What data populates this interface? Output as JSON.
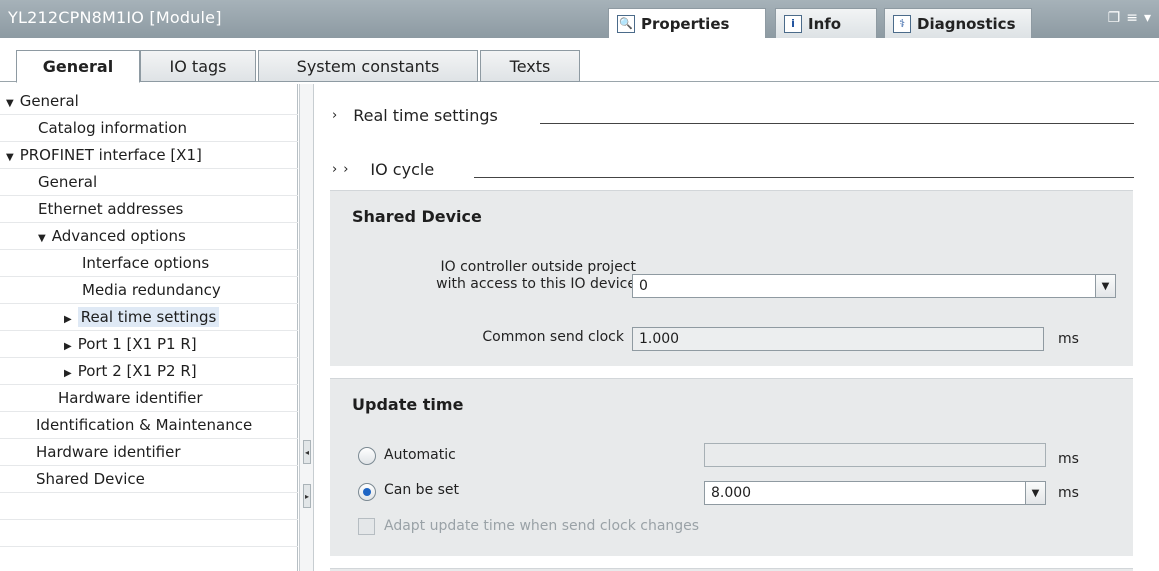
{
  "title": "YL212CPN8M1IO [Module]",
  "top_tabs": [
    {
      "label": "Properties",
      "icon": "properties-icon"
    },
    {
      "label": "Info",
      "icon": "info-icon"
    },
    {
      "label": "Diagnostics",
      "icon": "diagnostics-icon"
    }
  ],
  "sub_tabs": [
    "General",
    "IO tags",
    "System constants",
    "Texts"
  ],
  "tree": [
    {
      "label": "General",
      "caret": "down"
    },
    {
      "label": "Catalog information"
    },
    {
      "label": "PROFINET interface [X1]",
      "caret": "down"
    },
    {
      "label": "General"
    },
    {
      "label": "Ethernet addresses"
    },
    {
      "label": "Advanced options",
      "caret": "down"
    },
    {
      "label": "Interface options"
    },
    {
      "label": "Media redundancy"
    },
    {
      "label": "Real time settings",
      "caret": "right",
      "selected": true
    },
    {
      "label": "Port 1 [X1 P1 R]",
      "caret": "right"
    },
    {
      "label": "Port 2 [X1 P2 R]",
      "caret": "right"
    },
    {
      "label": "Hardware identifier"
    },
    {
      "label": "Identification & Maintenance"
    },
    {
      "label": "Hardware identifier"
    },
    {
      "label": "Shared Device"
    }
  ],
  "content": {
    "section1": "Real time settings",
    "section2": "IO cycle",
    "shared_device": {
      "heading": "Shared Device",
      "io_controller_label_line1": "IO controller outside project",
      "io_controller_label_line2": "with access to this IO device",
      "io_controller_value": "0",
      "send_clock_label": "Common send clock",
      "send_clock_value": "1.000",
      "send_clock_unit": "ms"
    },
    "update_time": {
      "heading": "Update time",
      "automatic_label": "Automatic",
      "automatic_value": "",
      "automatic_unit": "ms",
      "can_be_set_label": "Can be set",
      "can_be_set_value": "8.000",
      "can_be_set_unit": "ms",
      "adapt_label": "Adapt update time when send clock changes"
    }
  }
}
